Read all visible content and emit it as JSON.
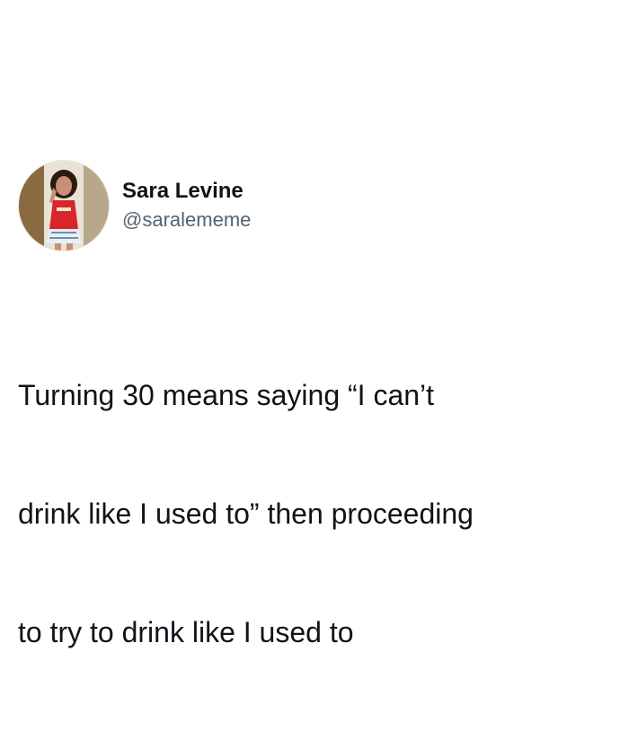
{
  "tweet": {
    "author": {
      "display_name": "Sara Levine",
      "handle": "@saralememe",
      "avatar": "profile-photo"
    },
    "text_lines": [
      "Turning 30 means saying “I can’t",
      "drink like I used to” then proceeding",
      "to try to drink like I used to"
    ]
  },
  "colors": {
    "background": "#ffffff",
    "text": "#0f1419",
    "secondary_text": "#536471"
  }
}
